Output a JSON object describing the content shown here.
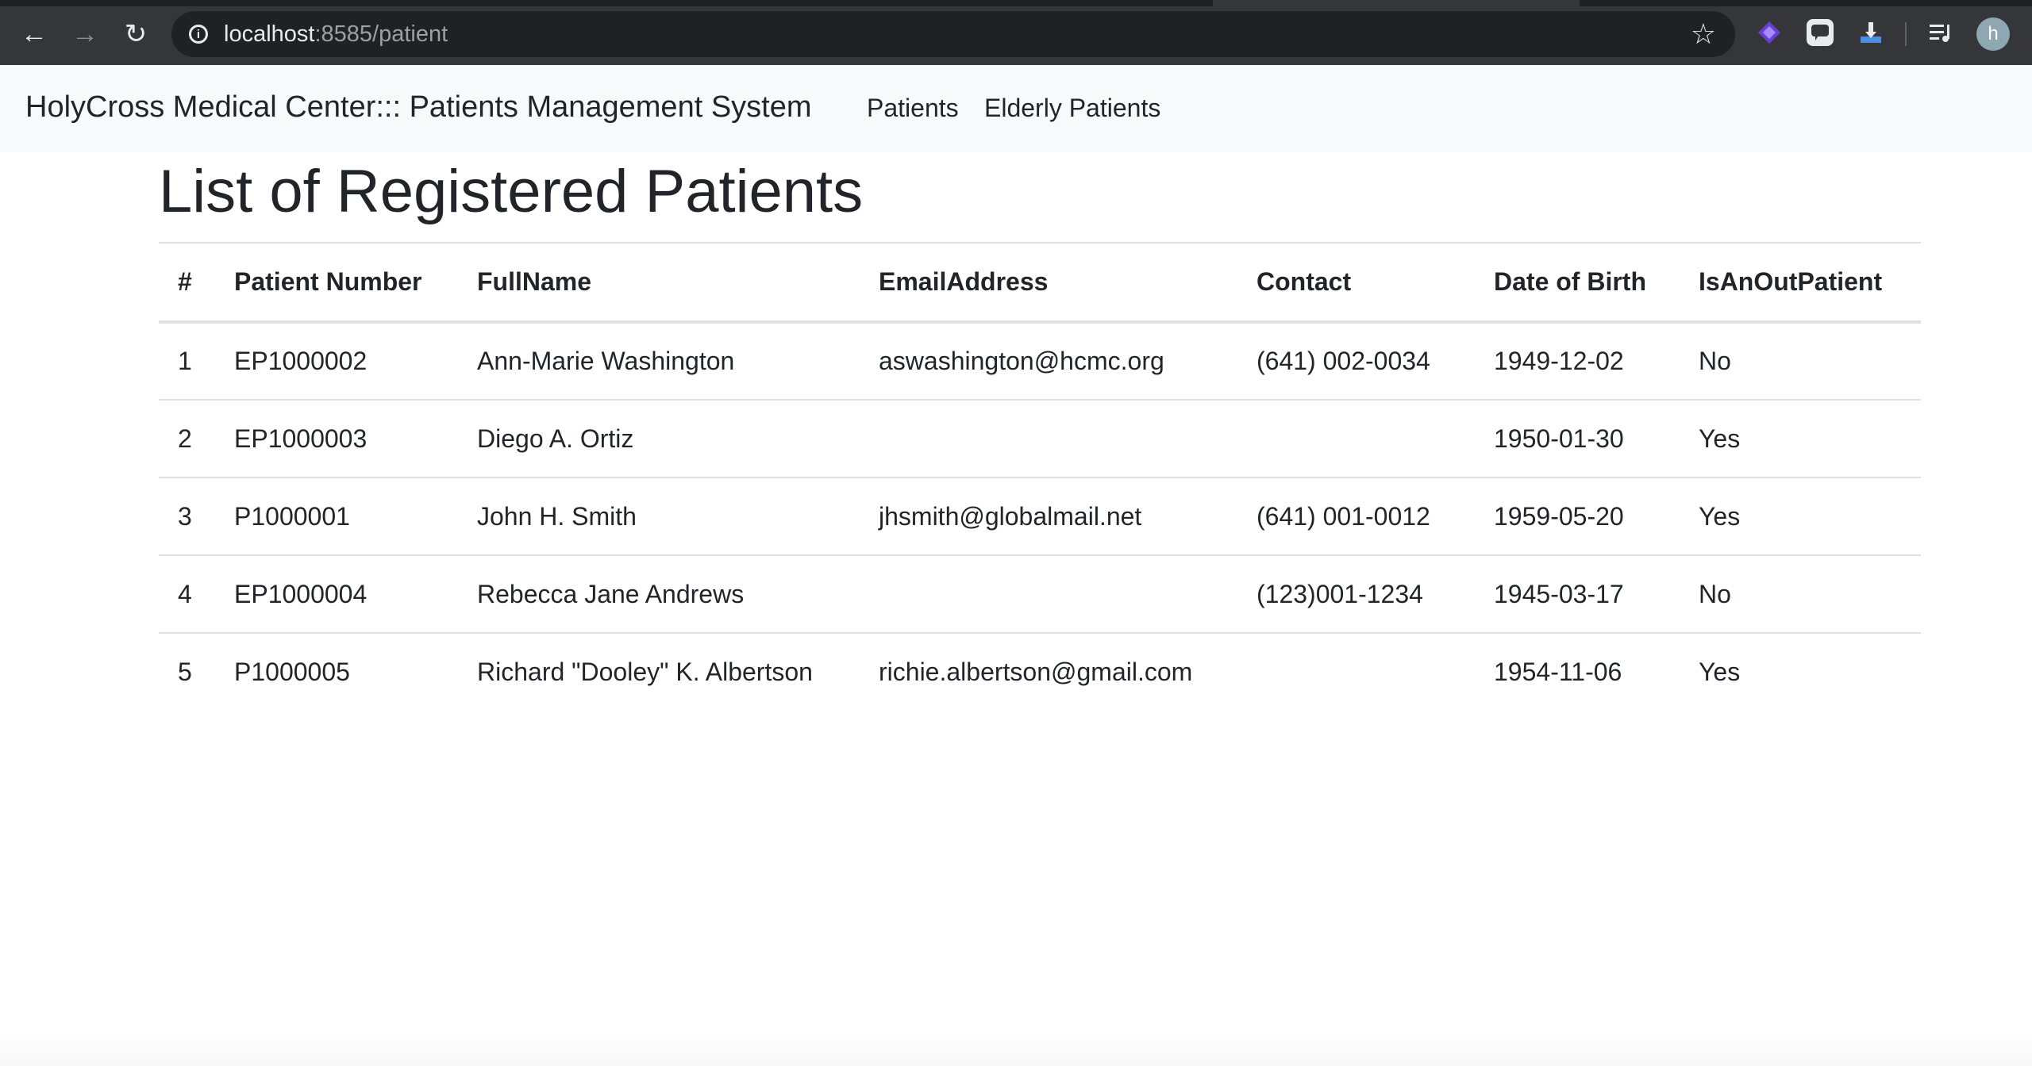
{
  "browser": {
    "url_host": "localhost",
    "url_rest": ":8585/patient",
    "back_icon": "←",
    "forward_icon": "→",
    "reload_icon": "↻",
    "star_icon": "☆",
    "profile_initial": "h"
  },
  "navbar": {
    "brand": "HolyCross Medical Center::: Patients Management System",
    "links": [
      "Patients",
      "Elderly Patients"
    ]
  },
  "main": {
    "title": "List of Registered Patients",
    "columns": [
      "#",
      "Patient Number",
      "FullName",
      "EmailAddress",
      "Contact",
      "Date of Birth",
      "IsAnOutPatient"
    ],
    "rows": [
      [
        "1",
        "EP1000002",
        "Ann-Marie Washington",
        "aswashington@hcmc.org",
        "(641) 002-0034",
        "1949-12-02",
        "No"
      ],
      [
        "2",
        "EP1000003",
        "Diego A. Ortiz",
        "",
        "",
        "1950-01-30",
        "Yes"
      ],
      [
        "3",
        "P1000001",
        "John H. Smith",
        "jhsmith@globalmail.net",
        "(641) 001-0012",
        "1959-05-20",
        "Yes"
      ],
      [
        "4",
        "EP1000004",
        "Rebecca Jane Andrews",
        "",
        "(123)001-1234",
        "1945-03-17",
        "No"
      ],
      [
        "5",
        "P1000005",
        "Richard \"Dooley\" K. Albertson",
        "richie.albertson@gmail.com",
        "",
        "1954-11-06",
        "Yes"
      ]
    ]
  }
}
